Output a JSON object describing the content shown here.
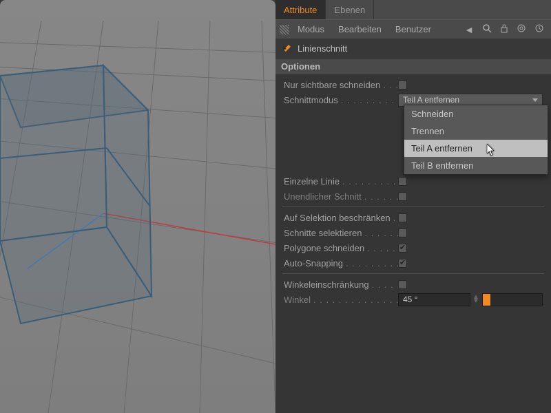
{
  "tabs": {
    "attributes": "Attribute",
    "layers": "Ebenen"
  },
  "menubar": {
    "mode": "Modus",
    "edit": "Bearbeiten",
    "user": "Benutzer"
  },
  "toolbar_icons": {
    "nav": "◄",
    "search": "search-icon",
    "lock": "lock-icon",
    "target": "target-icon",
    "history": "history-icon"
  },
  "tool": {
    "name": "Linienschnitt"
  },
  "section": {
    "options": "Optionen"
  },
  "options": {
    "only_visible": {
      "label": "Nur sichtbare schneiden",
      "checked": false
    },
    "cut_mode": {
      "label": "Schnittmodus",
      "value": "Teil A entfernen"
    },
    "single_line": {
      "label": "Einzelne Linie",
      "checked": false
    },
    "infinite_cut": {
      "label": "Unendlicher Schnitt",
      "checked": false
    },
    "restrict_selection": {
      "label": "Auf Selektion beschränken",
      "checked": false
    },
    "select_cuts": {
      "label": "Schnitte selektieren",
      "checked": false
    },
    "cut_polygons": {
      "label": "Polygone schneiden",
      "checked": true
    },
    "auto_snap": {
      "label": "Auto-Snapping",
      "checked": true
    },
    "angle_restrict": {
      "label": "Winkeleinschränkung",
      "checked": false
    },
    "angle": {
      "label": "Winkel",
      "value": "45 °"
    }
  },
  "dropdown_items": {
    "cut": "Schneiden",
    "split": "Trennen",
    "remove_a": "Teil A entfernen",
    "remove_b": "Teil B entfernen"
  }
}
